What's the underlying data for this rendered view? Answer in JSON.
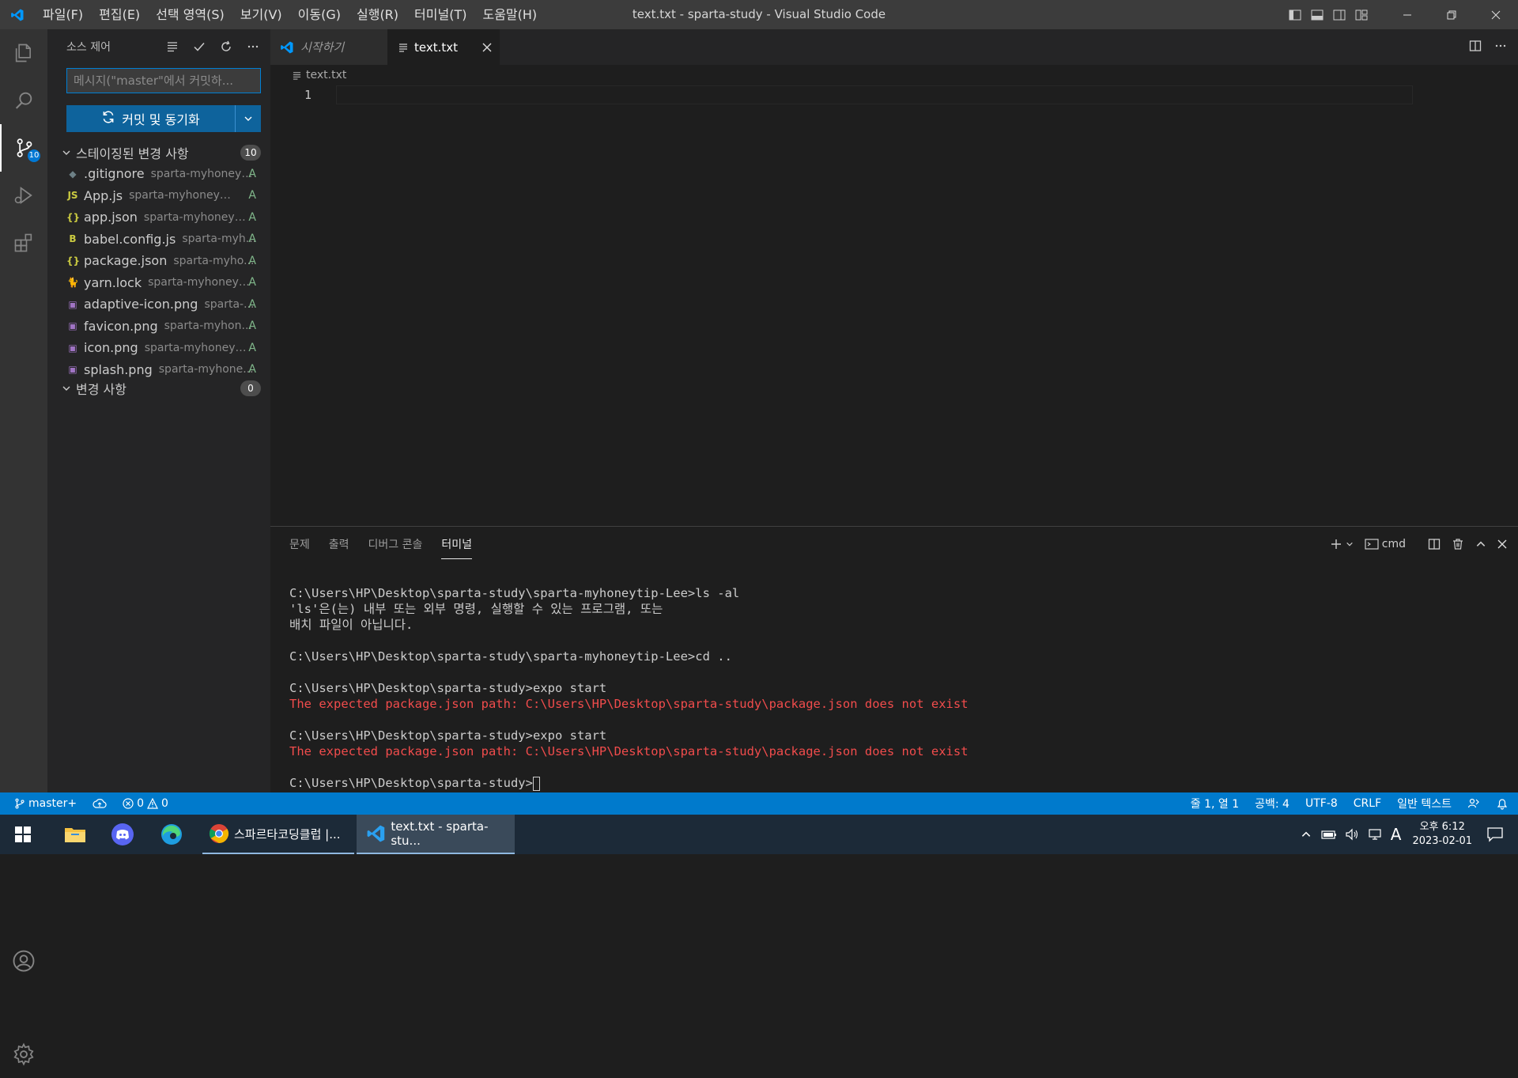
{
  "window": {
    "title": "text.txt - sparta-study - Visual Studio Code",
    "menu": [
      "파일(F)",
      "편집(E)",
      "선택 영역(S)",
      "보기(V)",
      "이동(G)",
      "실행(R)",
      "터미널(T)",
      "도움말(H)"
    ]
  },
  "activity": {
    "scm_badge": "10"
  },
  "sidebar": {
    "title": "소스 제어",
    "commit_placeholder": "메시지(\"master\"에서 커밋하...",
    "commit_button": "커밋 및 동기화",
    "staged": {
      "label": "스테이징된 변경 사항",
      "count": "10",
      "files": [
        {
          "name": ".gitignore",
          "path": "sparta-myhoneyt...",
          "status": "A",
          "icon": "◆",
          "color": "#6d8086"
        },
        {
          "name": "App.js",
          "path": "sparta-myhoneytip-L...",
          "status": "A",
          "icon": "JS",
          "color": "#cbcb41"
        },
        {
          "name": "app.json",
          "path": "sparta-myhoneyti...",
          "status": "A",
          "icon": "{}",
          "color": "#cbcb41"
        },
        {
          "name": "babel.config.js",
          "path": "sparta-myh...",
          "status": "A",
          "icon": "B",
          "color": "#cbcb41"
        },
        {
          "name": "package.json",
          "path": "sparta-myho...",
          "status": "A",
          "icon": "{}",
          "color": "#cbcb41"
        },
        {
          "name": "yarn.lock",
          "path": "sparta-myhoneyti...",
          "status": "A",
          "icon": "🐈",
          "color": "#519aba"
        },
        {
          "name": "adaptive-icon.png",
          "path": "sparta-...",
          "status": "A",
          "icon": "▣",
          "color": "#a074c4"
        },
        {
          "name": "favicon.png",
          "path": "sparta-myhon...",
          "status": "A",
          "icon": "▣",
          "color": "#a074c4"
        },
        {
          "name": "icon.png",
          "path": "sparta-myhoneyti...",
          "status": "A",
          "icon": "▣",
          "color": "#a074c4"
        },
        {
          "name": "splash.png",
          "path": "sparta-myhone...",
          "status": "A",
          "icon": "▣",
          "color": "#a074c4"
        }
      ]
    },
    "changes": {
      "label": "변경 사항",
      "count": "0"
    }
  },
  "tabs": [
    {
      "label": "시작하기"
    },
    {
      "label": "text.txt"
    }
  ],
  "editor": {
    "breadcrumb": "text.txt",
    "line_number": "1"
  },
  "panel": {
    "tabs": [
      "문제",
      "출력",
      "디버그 콘솔",
      "터미널"
    ],
    "shell": "cmd",
    "terminal": [
      {
        "text": "C:\\Users\\HP\\Desktop\\sparta-study\\sparta-myhoneytip-Lee>ls -al",
        "type": "normal"
      },
      {
        "text": "'ls'은(는) 내부 또는 외부 명령, 실행할 수 있는 프로그램, 또는",
        "type": "normal"
      },
      {
        "text": "배치 파일이 아닙니다.",
        "type": "normal"
      },
      {
        "text": "",
        "type": "normal"
      },
      {
        "text": "C:\\Users\\HP\\Desktop\\sparta-study\\sparta-myhoneytip-Lee>cd ..",
        "type": "normal"
      },
      {
        "text": "",
        "type": "normal"
      },
      {
        "text": "C:\\Users\\HP\\Desktop\\sparta-study>expo start",
        "type": "normal"
      },
      {
        "text": "The expected package.json path: C:\\Users\\HP\\Desktop\\sparta-study\\package.json does not exist",
        "type": "error"
      },
      {
        "text": "",
        "type": "normal"
      },
      {
        "text": "C:\\Users\\HP\\Desktop\\sparta-study>expo start",
        "type": "normal"
      },
      {
        "text": "The expected package.json path: C:\\Users\\HP\\Desktop\\sparta-study\\package.json does not exist",
        "type": "error"
      },
      {
        "text": "",
        "type": "normal"
      },
      {
        "text": "C:\\Users\\HP\\Desktop\\sparta-study>",
        "type": "prompt"
      }
    ]
  },
  "status": {
    "branch": "master+",
    "errors": "0",
    "warnings": "0",
    "position": "줄 1, 열 1",
    "spaces": "공백: 4",
    "encoding": "UTF-8",
    "eol": "CRLF",
    "language": "일반 텍스트"
  },
  "taskbar": {
    "chrome_label": "스파르타코딩클럽 |...",
    "vscode_label": "text.txt - sparta-stu...",
    "time": "오후 6:12",
    "date": "2023-02-01",
    "ime": "A"
  }
}
